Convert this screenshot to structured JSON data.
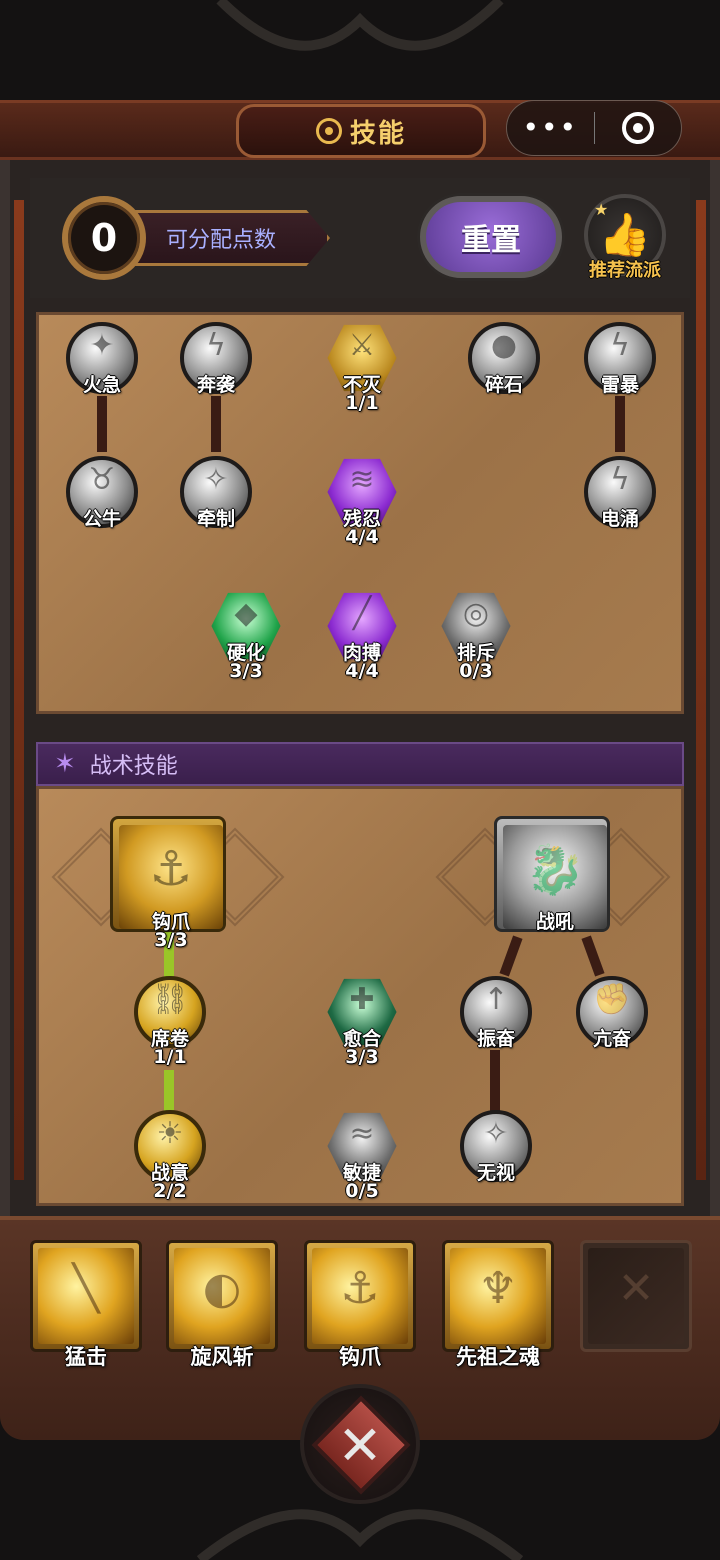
{
  "header": {
    "title": "技能",
    "wheel_icon": "wheel-icon"
  },
  "capsule": {
    "more_label": "•••",
    "target_icon": "target-icon"
  },
  "points": {
    "value": "0",
    "label": "可分配点数"
  },
  "reset_button": {
    "label": "重置"
  },
  "recommend_button": {
    "label": "推荐流派",
    "icon": "thumbs-up-icon"
  },
  "tree": {
    "nodes": [
      {
        "name": "火急",
        "level": ""
      },
      {
        "name": "奔袭",
        "level": ""
      },
      {
        "name": "不灭",
        "level": "1/1"
      },
      {
        "name": "碎石",
        "level": ""
      },
      {
        "name": "雷暴",
        "level": ""
      },
      {
        "name": "公牛",
        "level": ""
      },
      {
        "name": "牵制",
        "level": ""
      },
      {
        "name": "残忍",
        "level": "4/4"
      },
      {
        "name": "电涌",
        "level": ""
      },
      {
        "name": "硬化",
        "level": "3/3"
      },
      {
        "name": "肉搏",
        "level": "4/4"
      },
      {
        "name": "排斥",
        "level": "0/3"
      }
    ]
  },
  "tactics": {
    "header": "战术技能",
    "nodes": [
      {
        "name": "钩爪",
        "level": "3/3"
      },
      {
        "name": "战吼",
        "level": ""
      },
      {
        "name": "席卷",
        "level": "1/1"
      },
      {
        "name": "愈合",
        "level": "3/3"
      },
      {
        "name": "振奋",
        "level": ""
      },
      {
        "name": "亢奋",
        "level": ""
      },
      {
        "name": "战意",
        "level": "2/2"
      },
      {
        "name": "敏捷",
        "level": "0/5"
      },
      {
        "name": "无视",
        "level": ""
      }
    ]
  },
  "skill_bar": [
    {
      "name": "猛击"
    },
    {
      "name": "旋风斩"
    },
    {
      "name": "钩爪"
    },
    {
      "name": "先祖之魂"
    },
    {
      "name": ""
    }
  ],
  "close_button": {
    "glyph": "✕"
  }
}
